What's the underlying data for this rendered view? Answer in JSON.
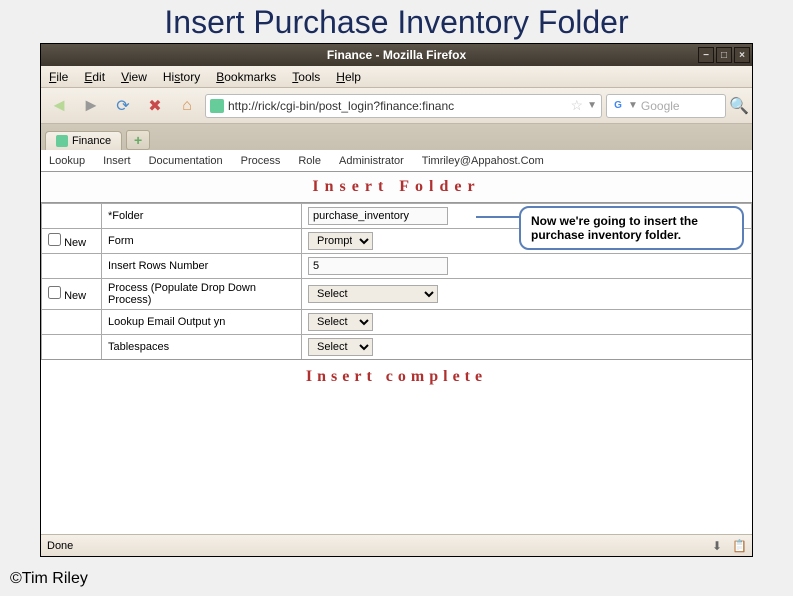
{
  "slide": {
    "title": "Insert Purchase Inventory Folder",
    "copyright": "©Tim Riley"
  },
  "window": {
    "title": "Finance - Mozilla Firefox"
  },
  "menubar": {
    "file": "File",
    "edit": "Edit",
    "view": "View",
    "history": "History",
    "bookmarks": "Bookmarks",
    "tools": "Tools",
    "help": "Help"
  },
  "toolbar": {
    "url": "http://rick/cgi-bin/post_login?finance:financ",
    "search_placeholder": "Google"
  },
  "tabs": {
    "active": "Finance"
  },
  "app_menu": {
    "items": [
      "Lookup",
      "Insert",
      "Documentation",
      "Process",
      "Role",
      "Administrator",
      "Timriley@Appahost.Com"
    ]
  },
  "page": {
    "heading": "Insert  Folder",
    "status": "Insert  complete"
  },
  "form": {
    "rows": [
      {
        "check_label": "",
        "label": "*Folder",
        "type": "text",
        "value": "purchase_inventory"
      },
      {
        "check_label": "New",
        "label": "Form",
        "type": "select",
        "value": "Prompt"
      },
      {
        "check_label": "",
        "label": "Insert Rows Number",
        "type": "number",
        "value": "5"
      },
      {
        "check_label": "New",
        "label": "Process (Populate Drop Down Process)",
        "type": "select_wide",
        "value": "Select"
      },
      {
        "check_label": "",
        "label": "Lookup Email Output yn",
        "type": "select",
        "value": "Select"
      },
      {
        "check_label": "",
        "label": "Tablespaces",
        "type": "select",
        "value": "Select"
      }
    ]
  },
  "callout": {
    "text": "Now we're going to insert the purchase inventory folder."
  },
  "statusbar": {
    "text": "Done"
  }
}
